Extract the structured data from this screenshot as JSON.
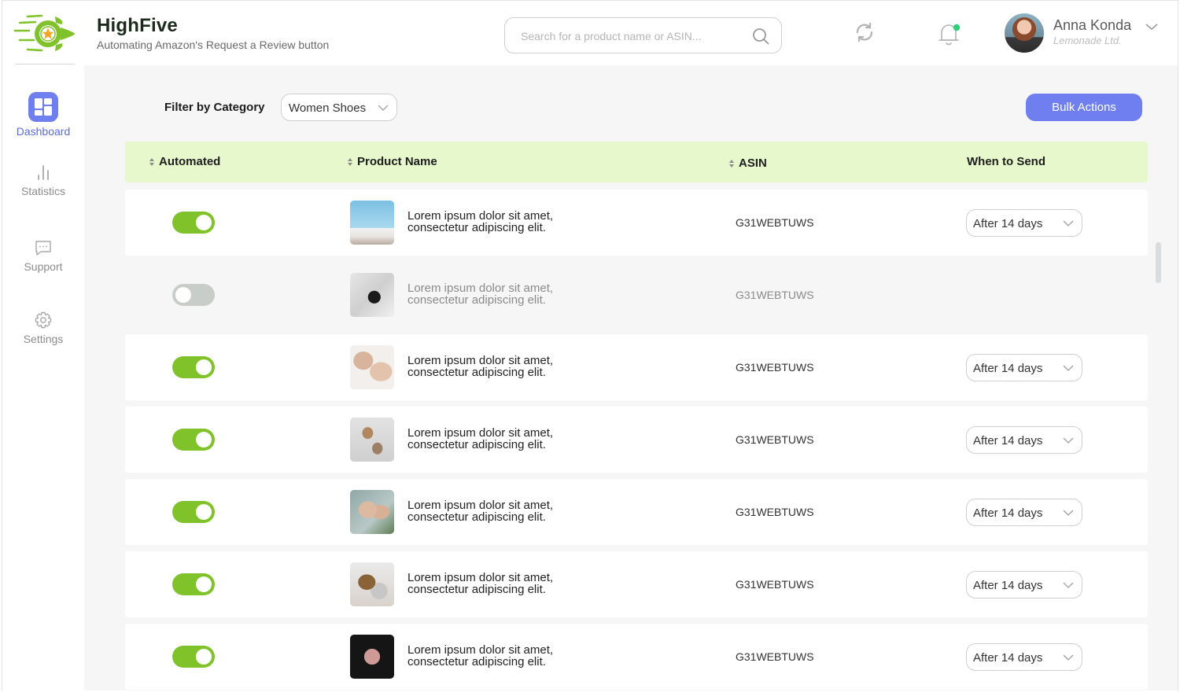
{
  "app": {
    "title": "HighFive",
    "subtitle": "Automating Amazon's Request a Review button"
  },
  "header": {
    "search_placeholder": "Search for a product name or ASIN...",
    "search_value": "",
    "user": {
      "name": "Anna Konda",
      "company": "Lemonade Ltd."
    },
    "notification_dot_color": "#2fd07a"
  },
  "sidebar": {
    "items": [
      {
        "label": "Dashboard",
        "icon": "dashboard-icon",
        "active": true
      },
      {
        "label": "Statistics",
        "icon": "bar-chart-icon",
        "active": false
      },
      {
        "label": "Support",
        "icon": "chat-icon",
        "active": false
      },
      {
        "label": "Settings",
        "icon": "gear-icon",
        "active": false
      }
    ]
  },
  "toolbar": {
    "filter_label": "Filter by Category",
    "filter_value": "Women Shoes",
    "bulk_actions_label": "Bulk Actions"
  },
  "table": {
    "columns": [
      {
        "label": "Automated",
        "sortable": true
      },
      {
        "label": "Product Name",
        "sortable": true
      },
      {
        "label": "ASIN",
        "sortable": true
      },
      {
        "label": "When to Send",
        "sortable": false
      }
    ],
    "rows": [
      {
        "automated": true,
        "product_name": "Lorem ipsum dolor sit amet, consectetur adipiscing elit.",
        "asin": "G31WEBTUWS",
        "when_to_send": "After 14 days"
      },
      {
        "automated": false,
        "product_name": "Lorem ipsum dolor sit amet, consectetur adipiscing elit.",
        "asin": "G31WEBTUWS",
        "when_to_send": ""
      },
      {
        "automated": true,
        "product_name": "Lorem ipsum dolor sit amet, consectetur adipiscing elit.",
        "asin": "G31WEBTUWS",
        "when_to_send": "After 14 days"
      },
      {
        "automated": true,
        "product_name": "Lorem ipsum dolor sit amet, consectetur adipiscing elit.",
        "asin": "G31WEBTUWS",
        "when_to_send": "After 14 days"
      },
      {
        "automated": true,
        "product_name": "Lorem ipsum dolor sit amet, consectetur adipiscing elit.",
        "asin": "G31WEBTUWS",
        "when_to_send": "After 14 days"
      },
      {
        "automated": true,
        "product_name": "Lorem ipsum dolor sit amet, consectetur adipiscing elit.",
        "asin": "G31WEBTUWS",
        "when_to_send": "After 14 days"
      },
      {
        "automated": true,
        "product_name": "Lorem ipsum dolor sit amet, consectetur adipiscing elit.",
        "asin": "G31WEBTUWS",
        "when_to_send": "After 14 days"
      }
    ]
  },
  "colors": {
    "accent": "#6f7ff0",
    "toggle_on": "#7fc22a",
    "toggle_off": "#c9cdc9",
    "table_header_bg": "#e7f8cd",
    "brand_green": "#7fc22a",
    "star_orange": "#f5a623"
  }
}
